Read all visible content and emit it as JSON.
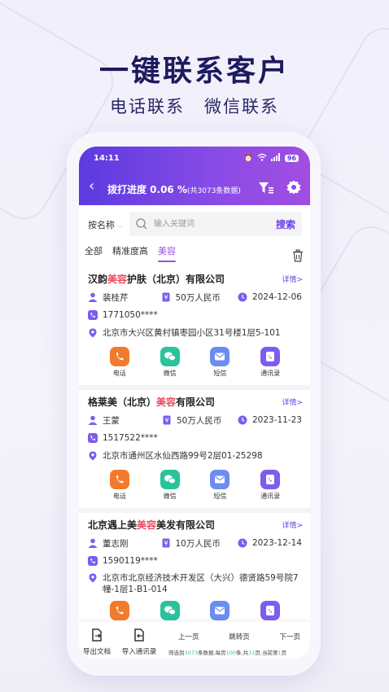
{
  "promo": {
    "title": "一键联系客户",
    "sub1": "电话联系",
    "sub2": "微信联系"
  },
  "status": {
    "time": "14:11",
    "battery": "96"
  },
  "nav": {
    "title": "拨打进度 0.06 %",
    "count": "(共3073条数据)"
  },
  "search": {
    "sort_label": "按名称",
    "placeholder": "输入关键词",
    "button": "搜索"
  },
  "tabs": [
    "全部",
    "精准度高",
    "美容"
  ],
  "active_tab": 2,
  "cards": [
    {
      "name_pre": "汉韵",
      "name_hl": "美容",
      "name_post": "护肤（北京）有限公司",
      "detail": "详情>",
      "person": "裴桂芹",
      "capital": "50万人民币",
      "date": "2024-12-06",
      "phone": "1771050****",
      "address": "北京市大兴区黄村镇枣园小区31号楼1层5-101"
    },
    {
      "name_pre": "格莱美（北京）",
      "name_hl": "美容",
      "name_post": "有限公司",
      "detail": "详情>",
      "person": "王蒙",
      "capital": "50万人民币",
      "date": "2023-11-23",
      "phone": "1517522****",
      "address": "北京市通州区水仙西路99号2层01-25298"
    },
    {
      "name_pre": "北京遇上美",
      "name_hl": "美容",
      "name_post": "美发有限公司",
      "detail": "详情>",
      "person": "董志刚",
      "capital": "10万人民币",
      "date": "2023-12-14",
      "phone": "1590119****",
      "address": "北京市北京经济技术开发区（大兴）德贤路59号院7幢-1层1-B1-014"
    }
  ],
  "actions": {
    "call": "电话",
    "wechat": "微信",
    "sms": "短信",
    "contacts": "通讯录"
  },
  "colors": {
    "call": "#f27a2c",
    "wechat": "#29c39c",
    "sms": "#6c8cf0",
    "contacts": "#7d5cf0",
    "accent": "#6a3fe0",
    "highlight": "#e84a5f"
  },
  "bottom": {
    "export": "导出文档",
    "import": "导入通讯录",
    "prev": "上一页",
    "jump": "跳转页",
    "next": "下一页",
    "stats_a": "筛选到",
    "stats_total": "3073",
    "stats_b": "条数据,每页",
    "stats_per": "100",
    "stats_c": "条,共",
    "stats_pages": "31",
    "stats_d": "页,当前第",
    "stats_cur": "1",
    "stats_e": "页"
  }
}
